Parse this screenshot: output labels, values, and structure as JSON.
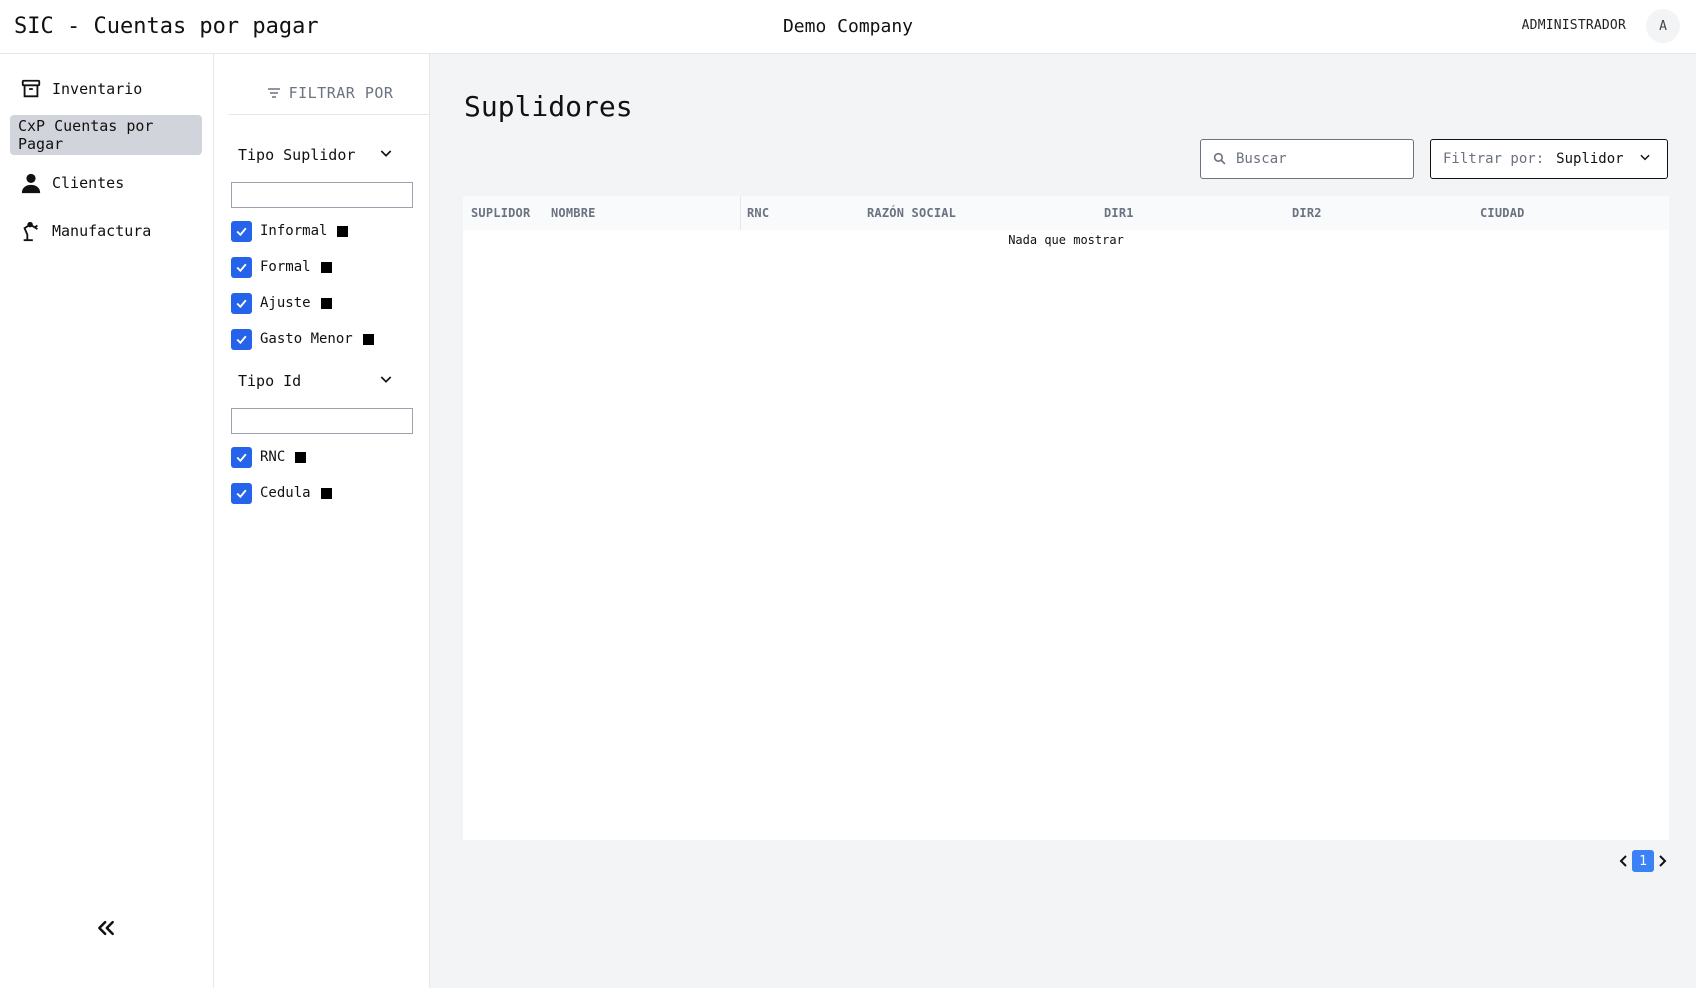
{
  "header": {
    "title": "SIC - Cuentas por pagar",
    "company": "Demo Company",
    "user_name": "ADMINISTRADOR",
    "avatar_initial": "A"
  },
  "sidebar": {
    "items": [
      {
        "label": "Inventario",
        "icon": "archive-box-icon",
        "active": false
      },
      {
        "label": "CxP Cuentas por Pagar",
        "icon": "",
        "active": true
      },
      {
        "label": "Clientes",
        "icon": "user-icon",
        "active": false
      },
      {
        "label": "Manufactura",
        "icon": "robot-arm-icon",
        "active": false
      }
    ],
    "collapse_icon": "double-chevron-left-icon"
  },
  "filters": {
    "title": "FILTRAR POR",
    "groups": [
      {
        "label": "Tipo Suplidor",
        "search_value": "",
        "options": [
          {
            "label": "Informal",
            "checked": true,
            "swatch": "#000000"
          },
          {
            "label": "Formal",
            "checked": true,
            "swatch": "#000000"
          },
          {
            "label": "Ajuste",
            "checked": true,
            "swatch": "#000000"
          },
          {
            "label": "Gasto Menor",
            "checked": true,
            "swatch": "#000000"
          }
        ]
      },
      {
        "label": "Tipo Id",
        "search_value": "",
        "options": [
          {
            "label": "RNC",
            "checked": true,
            "swatch": "#000000"
          },
          {
            "label": "Cedula",
            "checked": true,
            "swatch": "#000000"
          }
        ]
      }
    ]
  },
  "main": {
    "title": "Suplidores",
    "search_placeholder": "Buscar",
    "filter_label": "Filtrar por:",
    "filter_value": "Suplidor",
    "table": {
      "columns": [
        "SUPLIDOR",
        "NOMBRE",
        "RNC",
        "RAZÓN SOCIAL",
        "DIR1",
        "DIR2",
        "CIUDAD"
      ],
      "empty_message": "Nada que mostrar"
    },
    "pagination": {
      "current_page": "1"
    }
  },
  "colors": {
    "accent": "#2563eb",
    "page_button": "#3b82f6",
    "active_nav_bg": "#d1d5db",
    "main_bg": "#f3f4f6"
  }
}
